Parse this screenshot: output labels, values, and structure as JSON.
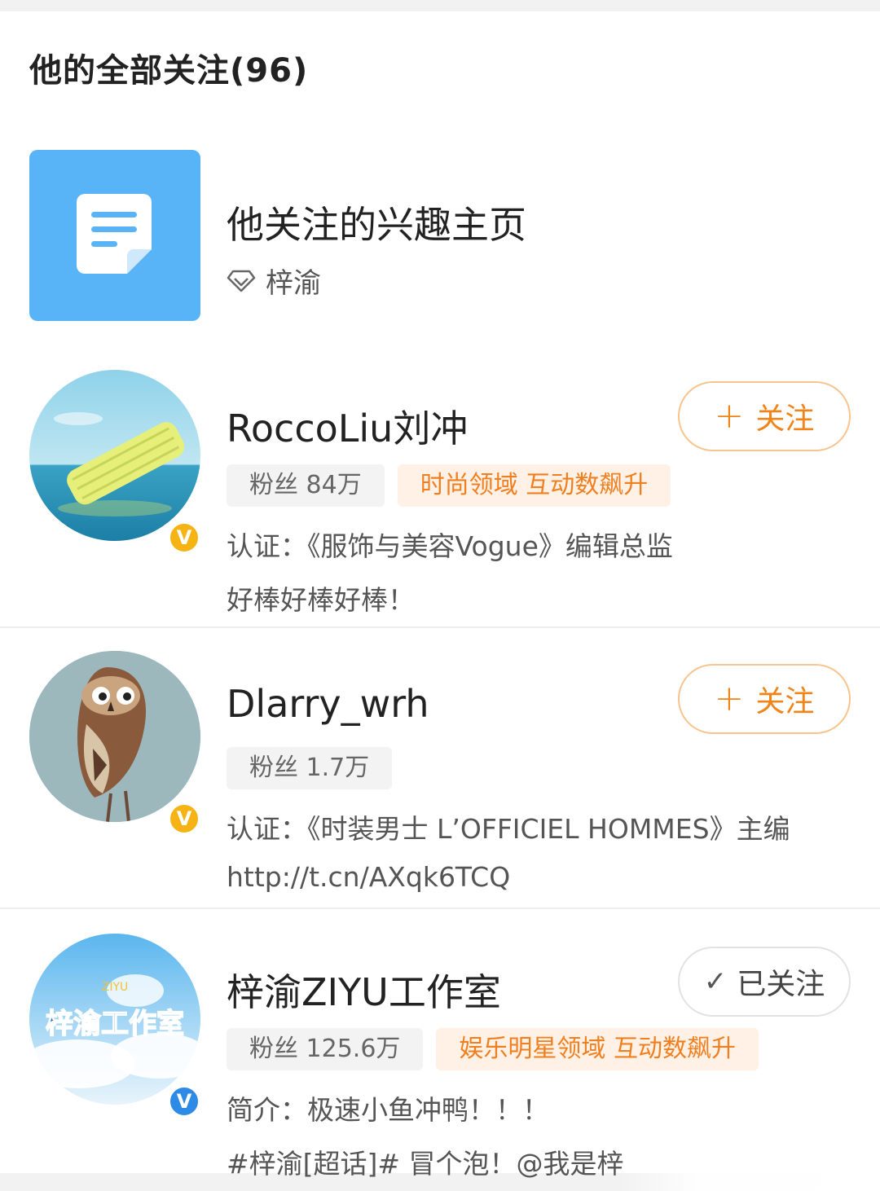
{
  "header": {
    "title": "他的全部关注(96)"
  },
  "interest": {
    "title": "他关注的兴趣主页",
    "sub": "梓渝",
    "icon": "document-icon"
  },
  "users": [
    {
      "name": "RoccoLiu刘冲",
      "button": {
        "icon": "+",
        "label": "关注"
      },
      "fans": "粉丝 84万",
      "hot": "时尚领域 互动数飙升",
      "line1": "认证：《服饰与美容Vogue》编辑总监",
      "line2": "好棒好棒好棒！",
      "verified": "V"
    },
    {
      "name": "Dlarry_wrh",
      "button": {
        "icon": "+",
        "label": "关注"
      },
      "fans": "粉丝 1.7万",
      "line1": "认证：《时装男士 L’OFFICIEL HOMMES》主编",
      "line2": "http://t.cn/AXqk6TCQ",
      "verified": "V"
    },
    {
      "name": "梓渝ZIYU工作室",
      "button": {
        "icon": "✓",
        "label": "已关注"
      },
      "fans": "粉丝 125.6万",
      "hot": "娱乐明星领域 互动数飙升",
      "line1": "简介：极速小鱼冲鸭！！！",
      "line2": "#梓渝[超话]# 冒个泡！@我是梓",
      "avatar_text": "梓渝工作室",
      "avatar_sub": "ZIYU",
      "verified": "V"
    }
  ],
  "colors": {
    "accent": "#f08419",
    "tile": "#58b3f7",
    "gold_badge": "#f5b414",
    "blue_badge": "#2d8ae6"
  }
}
